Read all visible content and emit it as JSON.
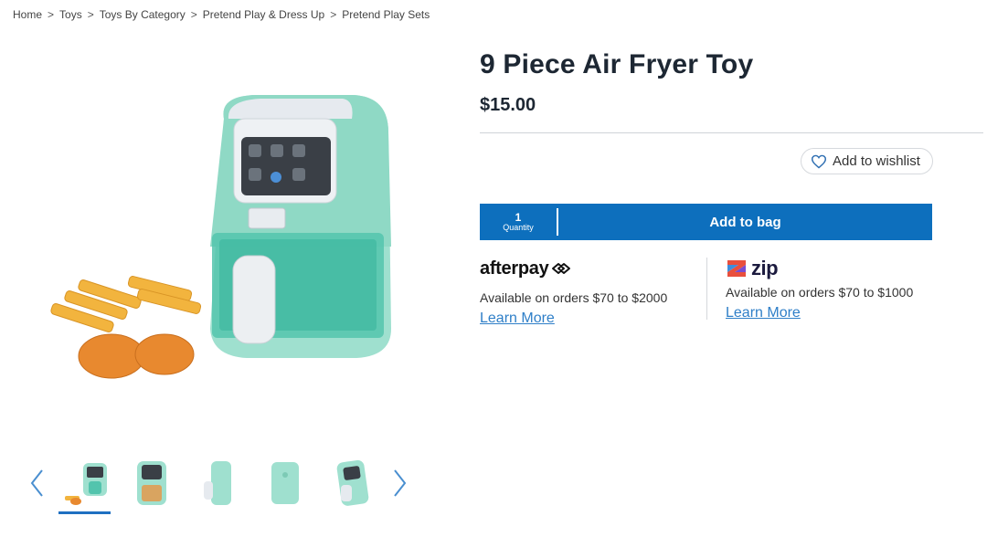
{
  "breadcrumb": {
    "items": [
      "Home",
      "Toys",
      "Toys By Category",
      "Pretend Play & Dress Up",
      "Pretend Play Sets"
    ],
    "separator": ">"
  },
  "product": {
    "title": "9 Piece Air Fryer Toy",
    "price": "$15.00"
  },
  "wishlist": {
    "label": "Add to wishlist",
    "icon": "heart-icon"
  },
  "purchase": {
    "quantity_value": "1",
    "quantity_label": "Quantity",
    "add_to_bag_label": "Add to bag"
  },
  "afterpay": {
    "logo_text": "afterpay",
    "description": "Available on orders $70 to $2000",
    "link": "Learn More"
  },
  "zip": {
    "logo_text": "zip",
    "description": "Available on orders $70 to $1000",
    "link": "Learn More"
  },
  "gallery": {
    "thumbnail_count": 5,
    "active_index": 0
  },
  "colors": {
    "accent_blue": "#0d6fbd",
    "link_blue": "#2f7fc8",
    "mint": "#8fdcc8"
  }
}
